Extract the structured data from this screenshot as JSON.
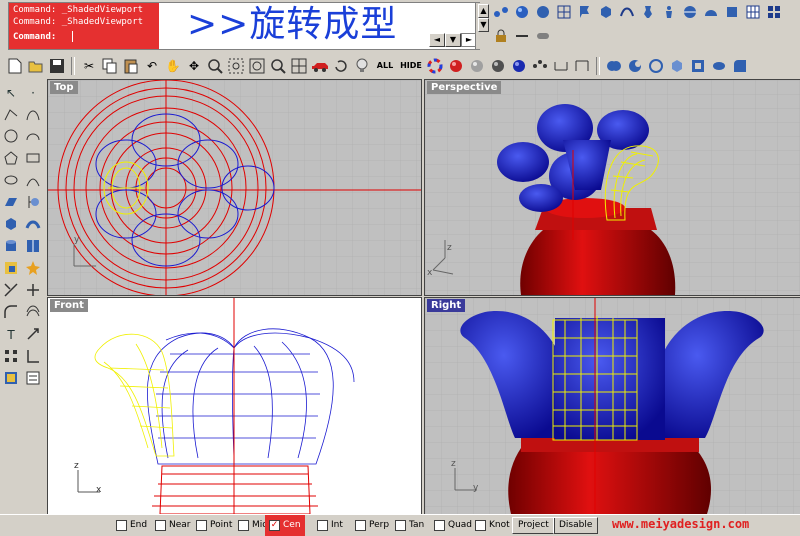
{
  "command": {
    "history": [
      "Command: _ShadedViewport",
      "Command: _ShadedViewport"
    ],
    "prompt_label": "Command:",
    "title_overlay": ">>旋转成型"
  },
  "viewports": {
    "top": "Top",
    "perspective": "Perspective",
    "front": "Front",
    "right": "Right",
    "axis_x": "x",
    "axis_y": "y",
    "axis_z": "z"
  },
  "toolbar": {
    "all_label": "ALL",
    "hide_label": "HIDE",
    "icons": [
      "new-icon",
      "open-icon",
      "save-icon",
      "cut-icon",
      "copy-icon",
      "paste-icon",
      "undo-icon",
      "pan-icon",
      "move-icon",
      "zoom-icon",
      "zoom-window-icon",
      "zoom-extents-icon",
      "zoom-selected-icon",
      "grid-icon",
      "car-icon",
      "rotate-icon"
    ]
  },
  "status": {
    "snaps": [
      {
        "label": "End",
        "checked": false
      },
      {
        "label": "Near",
        "checked": false
      },
      {
        "label": "Point",
        "checked": false
      },
      {
        "label": "Mid",
        "checked": false
      },
      {
        "label": "Cen",
        "checked": true
      },
      {
        "label": "Int",
        "checked": false
      },
      {
        "label": "Perp",
        "checked": false
      },
      {
        "label": "Tan",
        "checked": false
      },
      {
        "label": "Quad",
        "checked": false
      },
      {
        "label": "Knot",
        "checked": false
      }
    ],
    "project_label": "Project",
    "disable_label": "Disable",
    "site": "www.meiyadesign.com"
  },
  "colors": {
    "red_highlight": "#e53030",
    "title_blue": "#1a3fd8",
    "wire_blue": "#1a1ad0",
    "wire_red": "#e00000",
    "wire_yellow": "#f0f000",
    "active_label": "#3a3a9a"
  }
}
